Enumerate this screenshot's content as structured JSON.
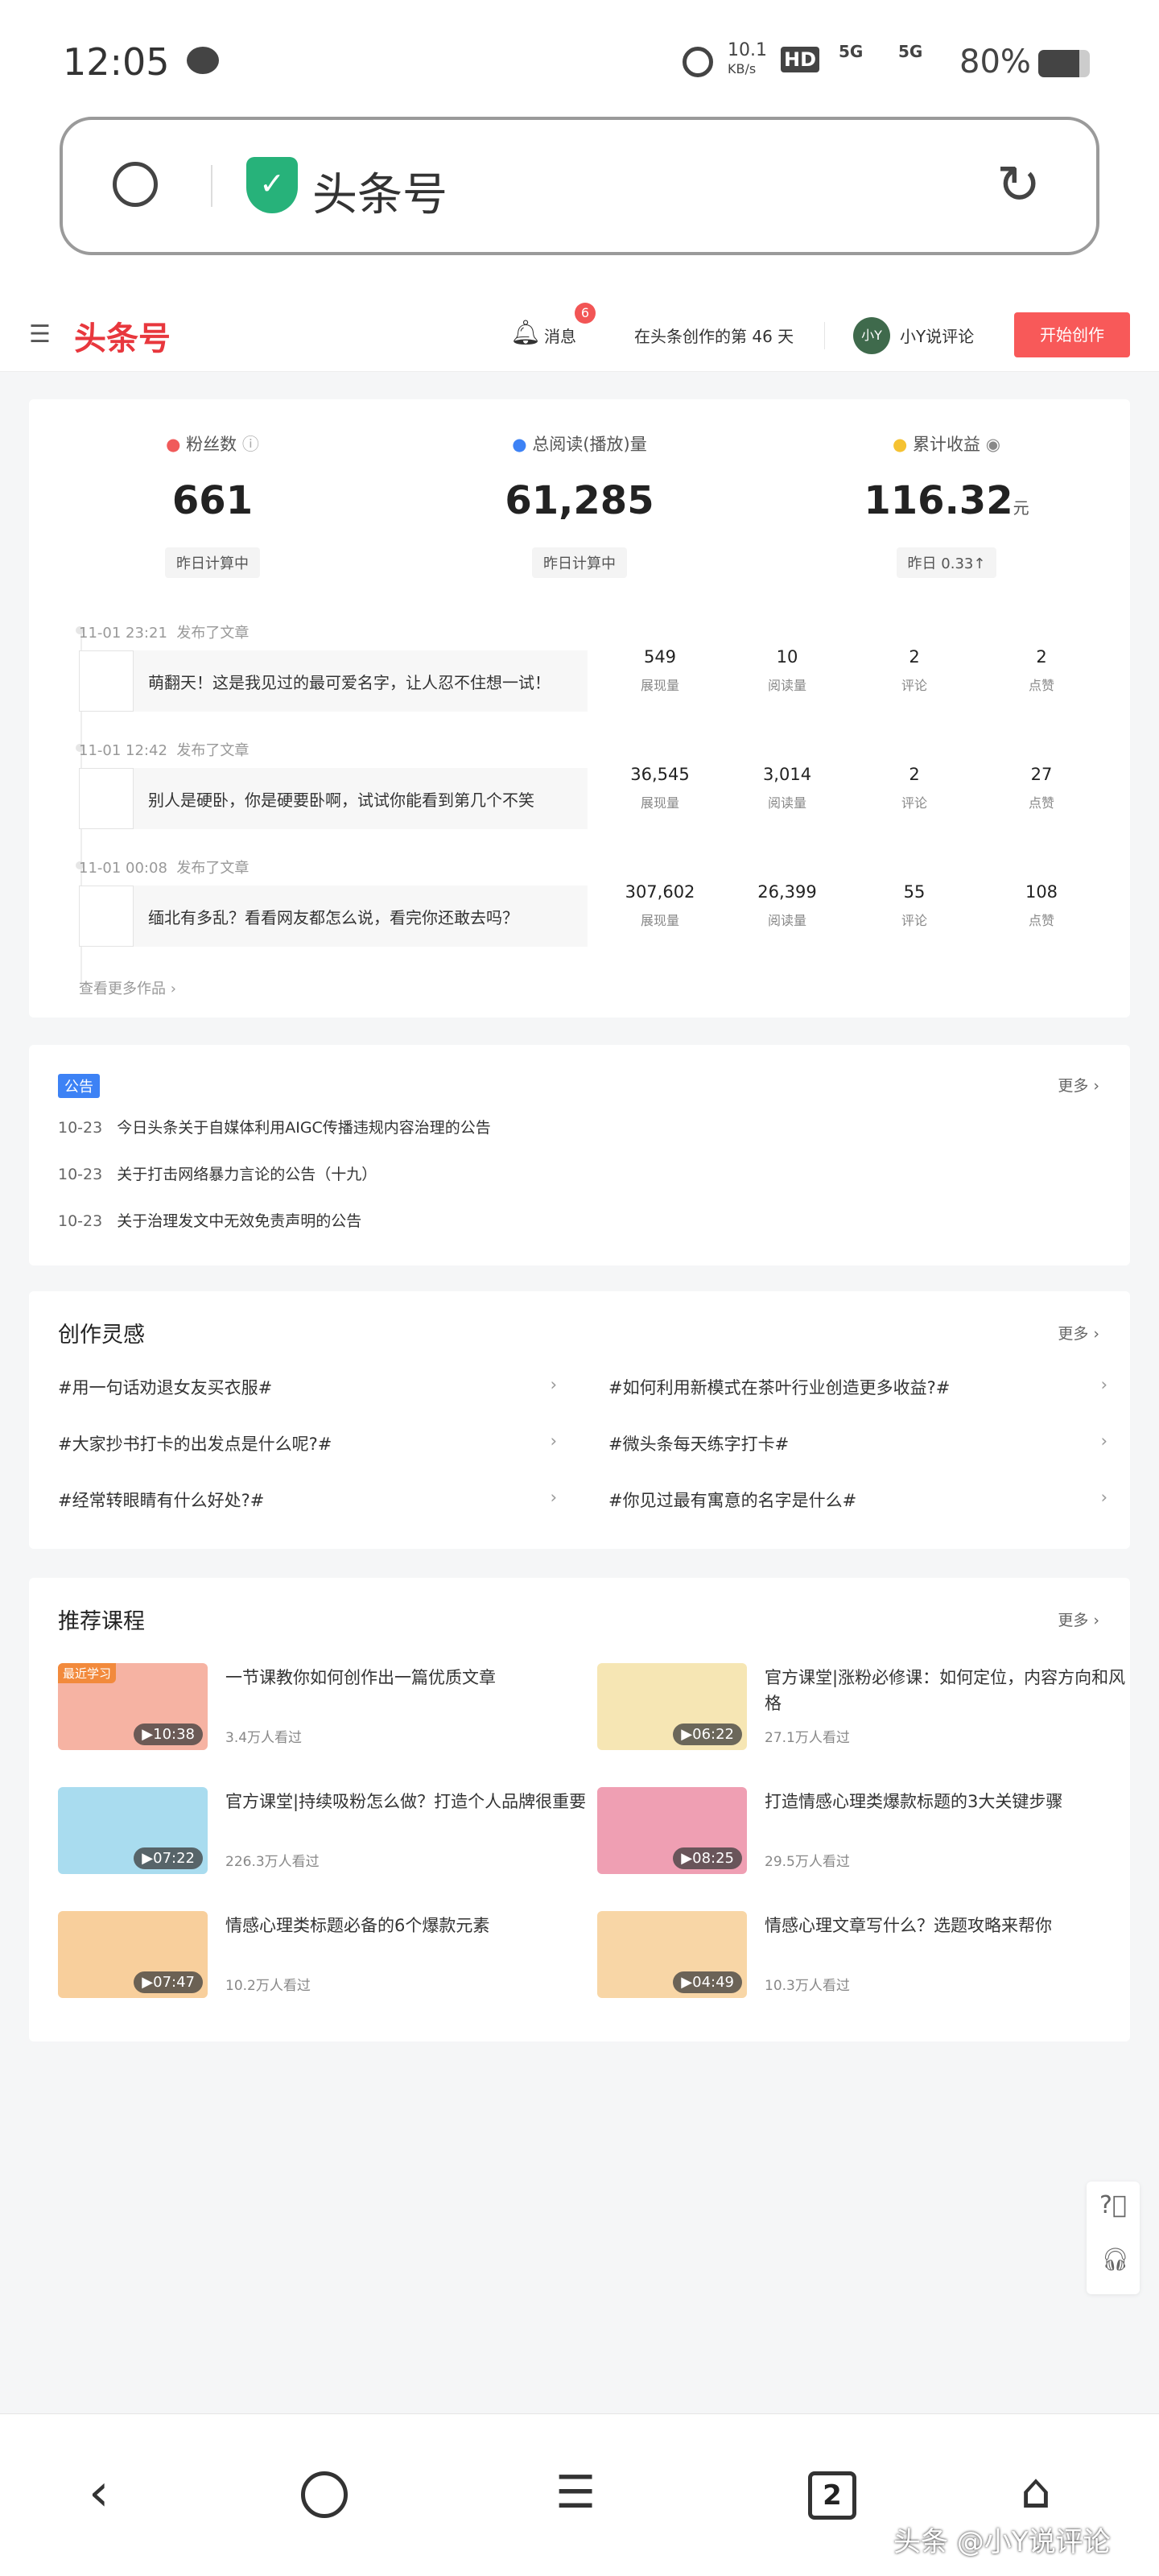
{
  "status": {
    "time": "12:05",
    "speed": "10.1",
    "speed_unit": "KB/s",
    "hd": "HD",
    "net1": "5G",
    "net2": "5G",
    "battery": "80%"
  },
  "browser": {
    "url_title": "头条号"
  },
  "header": {
    "logo": "头条号",
    "messages_label": "消息",
    "messages_badge": "6",
    "days_text": "在头条创作的第 46 天",
    "avatar_text": "小Y",
    "username": "小Y说评论",
    "create_button": "开始创作"
  },
  "stats": [
    {
      "label": "粉丝数",
      "value": "661",
      "unit": "",
      "sub": "昨日计算中",
      "color": "#f05a5a"
    },
    {
      "label": "总阅读(播放)量",
      "value": "61,285",
      "unit": "",
      "sub": "昨日计算中",
      "color": "#3d82f5"
    },
    {
      "label": "累计收益",
      "value": "116.32",
      "unit": "元",
      "sub": "昨日 0.33↑",
      "color": "#f5c232"
    }
  ],
  "metric_labels": [
    "展现量",
    "阅读量",
    "评论",
    "点赞"
  ],
  "articles": [
    {
      "time": "11-01 23:21",
      "action": "发布了文章",
      "title": "萌翻天！这是我见过的最可爱名字，让人忍不住想一试！",
      "metrics": [
        "549",
        "10",
        "2",
        "2"
      ]
    },
    {
      "time": "11-01 12:42",
      "action": "发布了文章",
      "title": "别人是硬卧，你是硬要卧啊，试试你能看到第几个不笑",
      "metrics": [
        "36,545",
        "3,014",
        "2",
        "27"
      ]
    },
    {
      "time": "11-01 00:08",
      "action": "发布了文章",
      "title": "缅北有多乱？看看网友都怎么说，看完你还敢去吗？",
      "metrics": [
        "307,602",
        "26,399",
        "55",
        "108"
      ]
    }
  ],
  "more_works": "查看更多作品 ›",
  "announcements": {
    "tag": "公告",
    "more": "更多 ›",
    "items": [
      {
        "date": "10-23",
        "text": "今日头条关于自媒体利用AIGC传播违规内容治理的公告"
      },
      {
        "date": "10-23",
        "text": "关于打击网络暴力言论的公告（十九）"
      },
      {
        "date": "10-23",
        "text": "关于治理发文中无效免责声明的公告"
      }
    ]
  },
  "inspiration": {
    "title": "创作灵感",
    "more": "更多 ›",
    "topics": [
      "#用一句话劝退女友买衣服#",
      "#如何利用新模式在茶叶行业创造更多收益?#",
      "#大家抄书打卡的出发点是什么呢?#",
      "#微头条每天练字打卡#",
      "#经常转眼睛有什么好处?#",
      "#你见过最有寓意的名字是什么#"
    ]
  },
  "courses": {
    "title": "推荐课程",
    "more": "更多 ›",
    "recent_tag": "最近学习",
    "items": [
      {
        "title": "一节课教你如何创作出一篇优质文章",
        "views": "3.4万人看过",
        "duration": "10:38",
        "color": "#f6b3a3"
      },
      {
        "title": "官方课堂|涨粉必修课：如何定位，内容方向和风格",
        "views": "27.1万人看过",
        "duration": "06:22",
        "color": "#f6e6b4"
      },
      {
        "title": "官方课堂|持续吸粉怎么做？打造个人品牌很重要",
        "views": "226.3万人看过",
        "duration": "07:22",
        "color": "#a9dcef"
      },
      {
        "title": "打造情感心理类爆款标题的3大关键步骤",
        "views": "29.5万人看过",
        "duration": "08:25",
        "color": "#ef9fb3"
      },
      {
        "title": "情感心理类标题必备的6个爆款元素",
        "views": "10.2万人看过",
        "duration": "07:47",
        "color": "#f8cf9c"
      },
      {
        "title": "情感心理文章写什么？选题攻略来帮你",
        "views": "10.3万人看过",
        "duration": "04:49",
        "color": "#f8d6a6"
      }
    ]
  },
  "bottom_nav": {
    "tabs_count": "2",
    "watermark": "头条 @小Y说评论"
  }
}
